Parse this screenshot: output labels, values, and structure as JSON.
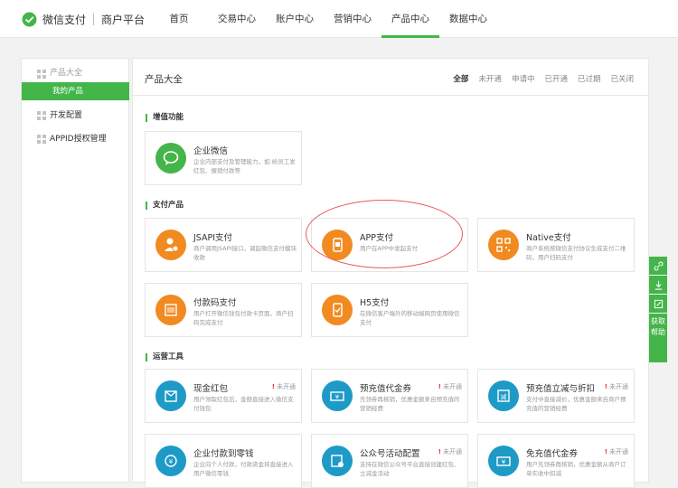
{
  "brand": {
    "name": "微信支付",
    "sub": "商户平台"
  },
  "nav": [
    "首页",
    "交易中心",
    "账户中心",
    "营销中心",
    "产品中心",
    "数据中心"
  ],
  "nav_active": "产品中心",
  "sidebar": {
    "groups": [
      {
        "label": "产品大全",
        "sub": [
          "我的产品"
        ]
      },
      {
        "label": "开发配置"
      },
      {
        "label": "APPID授权管理"
      }
    ]
  },
  "main": {
    "title": "产品大全",
    "filters": [
      "全部",
      "未开通",
      "申请中",
      "已开通",
      "已过期",
      "已关闭"
    ],
    "active_filter": "全部"
  },
  "sections": [
    {
      "title": "增值功能"
    },
    {
      "title": "支付产品"
    },
    {
      "title": "运营工具"
    }
  ],
  "cards": [
    {
      "name": "企业微信",
      "desc": "企业内部支付及管理能力，如:给员工发红包、报销付款等",
      "color": "green",
      "icon": "chat-bubble-icon"
    },
    {
      "name": "JSAPI支付",
      "desc": "商户调用JSAPI接口，调起微信支付模块收款",
      "color": "orange",
      "icon": "user-pay-icon"
    },
    {
      "name": "APP支付",
      "desc": "用户在APP中发起支付",
      "color": "orange",
      "icon": "phone-app-icon"
    },
    {
      "name": "Native支付",
      "desc": "商户系统按微信支付协议生成支付二维码，用户扫码支付",
      "color": "orange",
      "icon": "qrcode-icon"
    },
    {
      "name": "付款码支付",
      "desc": "用户打开微信钱包付款卡页面，商户扫码完成支付",
      "color": "orange",
      "icon": "barcode-icon"
    },
    {
      "name": "H5支付",
      "desc": "在微信客户端外的移动端网页使用微信支付",
      "color": "orange",
      "icon": "mobile-check-icon"
    },
    {
      "name": "现金红包",
      "desc": "用户领取红包后，金额直接进入微信支付钱包",
      "color": "blue",
      "icon": "envelope-icon",
      "status": "未开通"
    },
    {
      "name": "预充值代金券",
      "desc": "先领券再核销，优惠金额来自预充值的营销经费",
      "color": "blue",
      "icon": "coupon-yen-icon",
      "status": "未开通"
    },
    {
      "name": "预充值立减与折扣",
      "desc": "支付中直接减价，优惠金额来自商户预充值的营销经费",
      "color": "blue",
      "icon": "discount-tag-icon",
      "status": "未开通"
    },
    {
      "name": "企业付款到零钱",
      "desc": "企业向个人付款，付款资金将直接进入用户微信零钱",
      "color": "blue",
      "icon": "transfer-yen-icon"
    },
    {
      "name": "公众号活动配置",
      "desc": "支持在微信公众号平台直接创建红包、立减金活动",
      "color": "blue",
      "icon": "gear-yen-icon",
      "status": "未开通"
    },
    {
      "name": "免充值代金券",
      "desc": "用户先领券再核销，优惠金额从商户订单实收中扣减",
      "color": "blue",
      "icon": "coupon-yen-icon",
      "status": "未开通"
    }
  ],
  "status_mark": "!",
  "float_help": "获取帮助",
  "colors": {
    "accent": "#44b549",
    "orange": "#f18a20",
    "blue": "#1e9ac7",
    "annotation": "#e85b5b"
  }
}
